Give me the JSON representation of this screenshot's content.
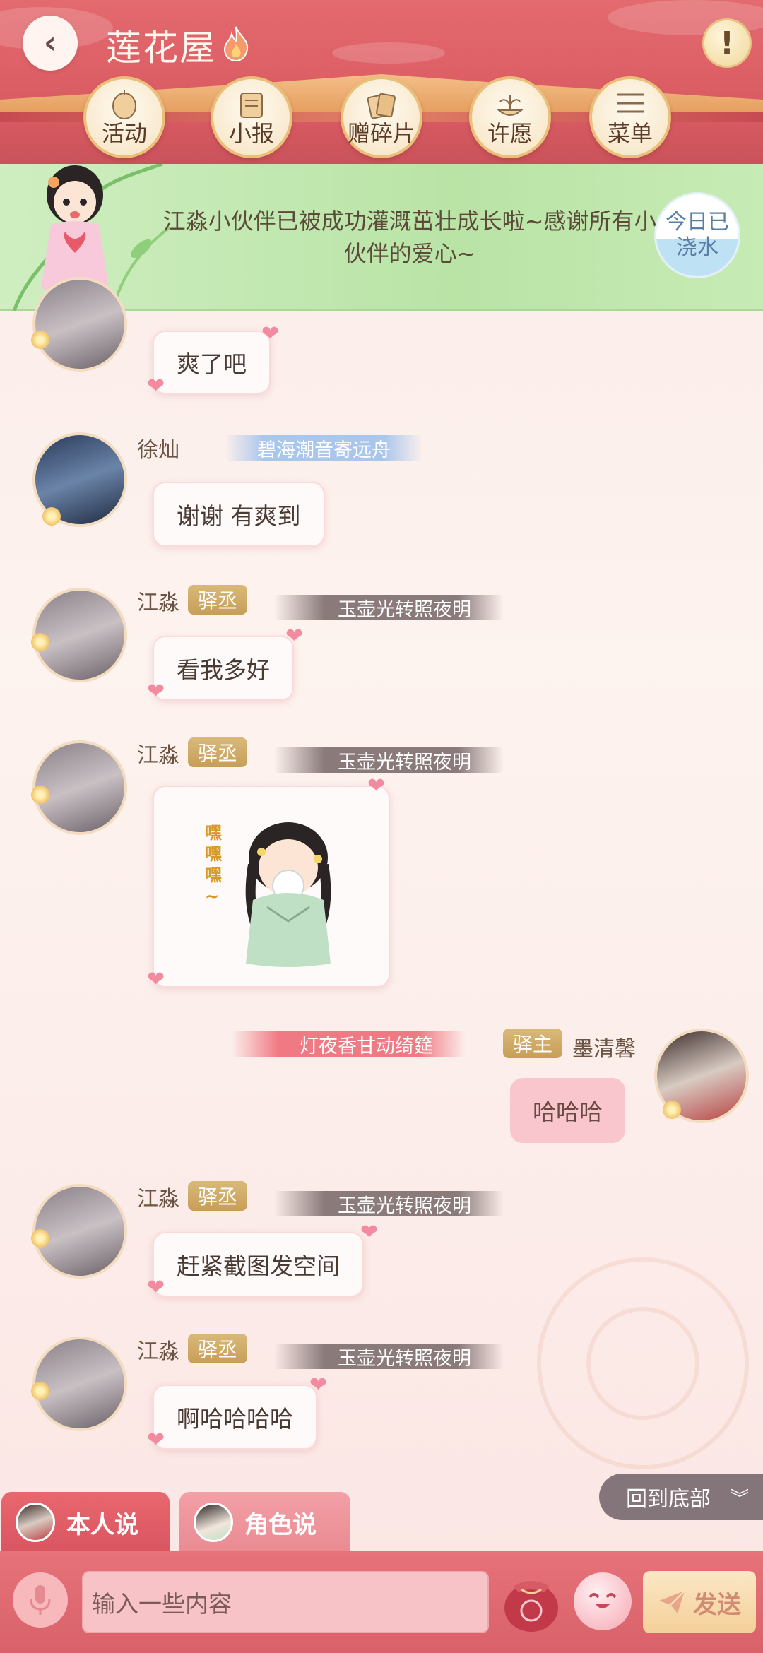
{
  "header": {
    "title": "莲花屋",
    "nav": [
      {
        "label": "活动"
      },
      {
        "label": "小报"
      },
      {
        "label": "赠碎片"
      },
      {
        "label": "许愿"
      },
      {
        "label": "菜单"
      }
    ]
  },
  "banner": {
    "text": "江淼小伙伴已被成功灌溉茁壮成长啦~感谢所有小伙伴的爱心~",
    "water_button": "今日已浇水"
  },
  "messages": [
    {
      "text": "爽了吧"
    },
    {
      "user": "徐灿",
      "title": "碧海潮音寄远舟",
      "text": "谢谢 有爽到"
    },
    {
      "user": "江淼",
      "badge": "驿丞",
      "title": "玉壶光转照夜明",
      "text": "看我多好"
    },
    {
      "user": "江淼",
      "badge": "驿丞",
      "title": "玉壶光转照夜明"
    },
    {
      "user": "墨清馨",
      "badge": "驿主",
      "title": "灯夜香甘动绮筵",
      "text": "哈哈哈"
    },
    {
      "user": "江淼",
      "badge": "驿丞",
      "title": "玉壶光转照夜明",
      "text": "赶紧截图发空间"
    },
    {
      "user": "江淼",
      "badge": "驿丞",
      "title": "玉壶光转照夜明",
      "text": "啊哈哈哈哈"
    }
  ],
  "back_to_bottom": "回到底部",
  "tabs": [
    {
      "label": "本人说"
    },
    {
      "label": "角色说"
    }
  ],
  "input": {
    "placeholder": "输入一些内容"
  },
  "send_label": "发送",
  "sticker": {
    "glyphs": "嘿嘿嘿~"
  },
  "colors": {
    "header": "#e36a6e",
    "banner": "#c7ebb5",
    "badge": "#c79e57",
    "self_bubble": "#f9c6cd",
    "bottom_bar": "#e7727a"
  }
}
